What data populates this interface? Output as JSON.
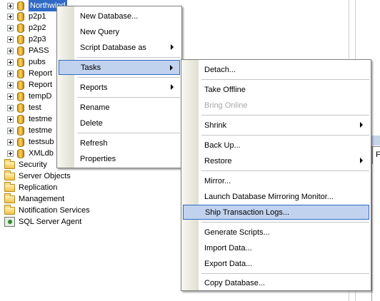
{
  "tree": {
    "databases": [
      "Northwind",
      "p2p1",
      "p2p2",
      "p2p3",
      "PASS",
      "pubs",
      "Report",
      "Report",
      "tempD",
      "test",
      "testme",
      "testme",
      "testsub",
      "XMLdb"
    ],
    "folders": [
      "Security",
      "Server Objects",
      "Replication",
      "Management",
      "Notification Services"
    ],
    "agent": "SQL Server Agent"
  },
  "right_pane": {
    "box_text": "F"
  },
  "context_menu": {
    "items": [
      {
        "label": "New Database..."
      },
      {
        "label": "New Query"
      },
      {
        "label": "Script Database as"
      },
      {
        "label": "Tasks"
      },
      {
        "label": "Reports"
      },
      {
        "label": "Rename"
      },
      {
        "label": "Delete"
      },
      {
        "label": "Refresh"
      },
      {
        "label": "Properties"
      }
    ]
  },
  "tasks_menu": {
    "items": [
      {
        "label": "Detach..."
      },
      {
        "label": "Take Offline"
      },
      {
        "label": "Bring Online"
      },
      {
        "label": "Shrink"
      },
      {
        "label": "Back Up..."
      },
      {
        "label": "Restore"
      },
      {
        "label": "Mirror..."
      },
      {
        "label": "Launch Database Mirroring Monitor..."
      },
      {
        "label": "Ship Transaction Logs..."
      },
      {
        "label": "Generate Scripts..."
      },
      {
        "label": "Import Data..."
      },
      {
        "label": "Export Data..."
      },
      {
        "label": "Copy Database..."
      }
    ]
  }
}
